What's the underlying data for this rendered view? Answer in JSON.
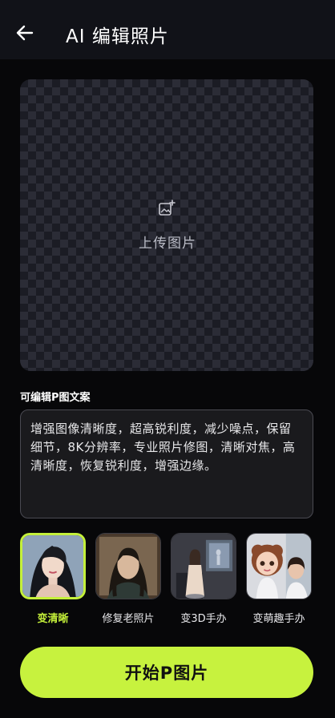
{
  "header": {
    "title": "AI 编辑照片",
    "back_icon": "arrow-left-icon"
  },
  "upload": {
    "label": "上传图片",
    "icon": "add-image-icon"
  },
  "prompt": {
    "label": "可编辑P图文案",
    "text": "增强图像清晰度，超高锐利度，减少噪点，保留细节，8K分辨率，专业照片修图，清晰对焦，高清晰度，恢复锐利度，增强边缘。"
  },
  "styles": [
    {
      "label": "变清晰",
      "selected": true
    },
    {
      "label": "修复老照片",
      "selected": false
    },
    {
      "label": "变3D手办",
      "selected": false
    },
    {
      "label": "变萌趣手办",
      "selected": false
    }
  ],
  "actions": {
    "start_label": "开始P图片"
  },
  "colors": {
    "accent": "#c7f23e",
    "background": "#070709",
    "header": "#111218"
  }
}
